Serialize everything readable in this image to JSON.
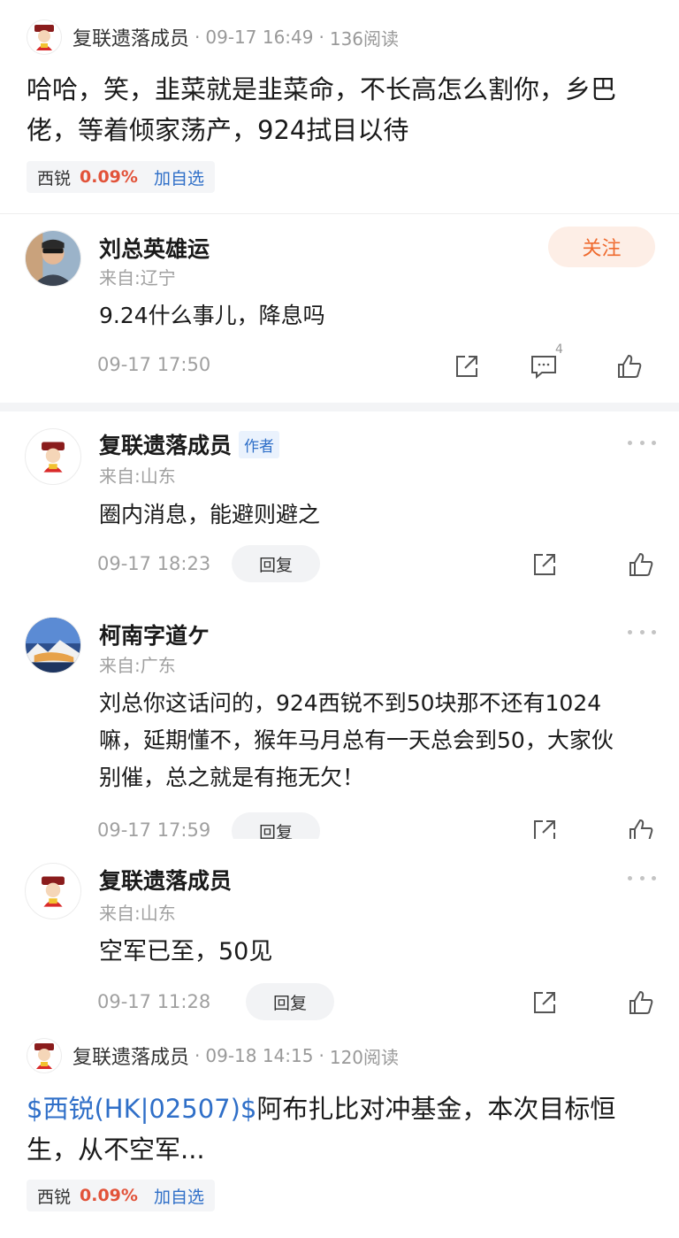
{
  "post1": {
    "author": "复联遗落成员",
    "time": "09-17 16:49",
    "reads": "136阅读",
    "text": "哈哈，笑，韭菜就是韭菜命，不长高怎么割你，乡巴佬，等着倾家荡产，924拭目以待",
    "chip": {
      "name": "西锐",
      "pct": "0.09%",
      "add": "加自选"
    }
  },
  "comment_main": {
    "name": "刘总英雄运",
    "location": "来自:辽宁",
    "follow": "关注",
    "text": "9.24什么事儿，降息吗",
    "time": "09-17 17:50",
    "comment_count": "4"
  },
  "replies": [
    {
      "name": "复联遗落成员",
      "tag": "作者",
      "location": "来自:山东",
      "text": "圈内消息，能避则避之",
      "time": "09-17 18:23",
      "reply": "回复"
    },
    {
      "name": "柯南字道ケ",
      "location": "来自:广东",
      "text": "刘总你这话问的，924西锐不到50块那不还有1024嘛，延期懂不，猴年马月总有一天总会到50，大家伙别催，总之就是有拖无欠！",
      "time": "09-17 17:59",
      "reply": "回复"
    },
    {
      "name": "复联遗落成员",
      "location": "来自:山东",
      "text": "空军已至，50见",
      "time": "09-17 11:28",
      "reply": "回复"
    }
  ],
  "post2": {
    "author": "复联遗落成员",
    "time": "09-18 14:15",
    "reads": "120阅读",
    "cashtag": "$西锐(HK|02507)$",
    "text": "阿布扎比对冲基金，本次目标恒生，从不空军...",
    "chip": {
      "name": "西锐",
      "pct": "0.09%",
      "add": "加自选"
    }
  },
  "colors": {
    "accent": "#2f6fc8",
    "up": "#e2533a",
    "follow": "#ef6a2e"
  }
}
